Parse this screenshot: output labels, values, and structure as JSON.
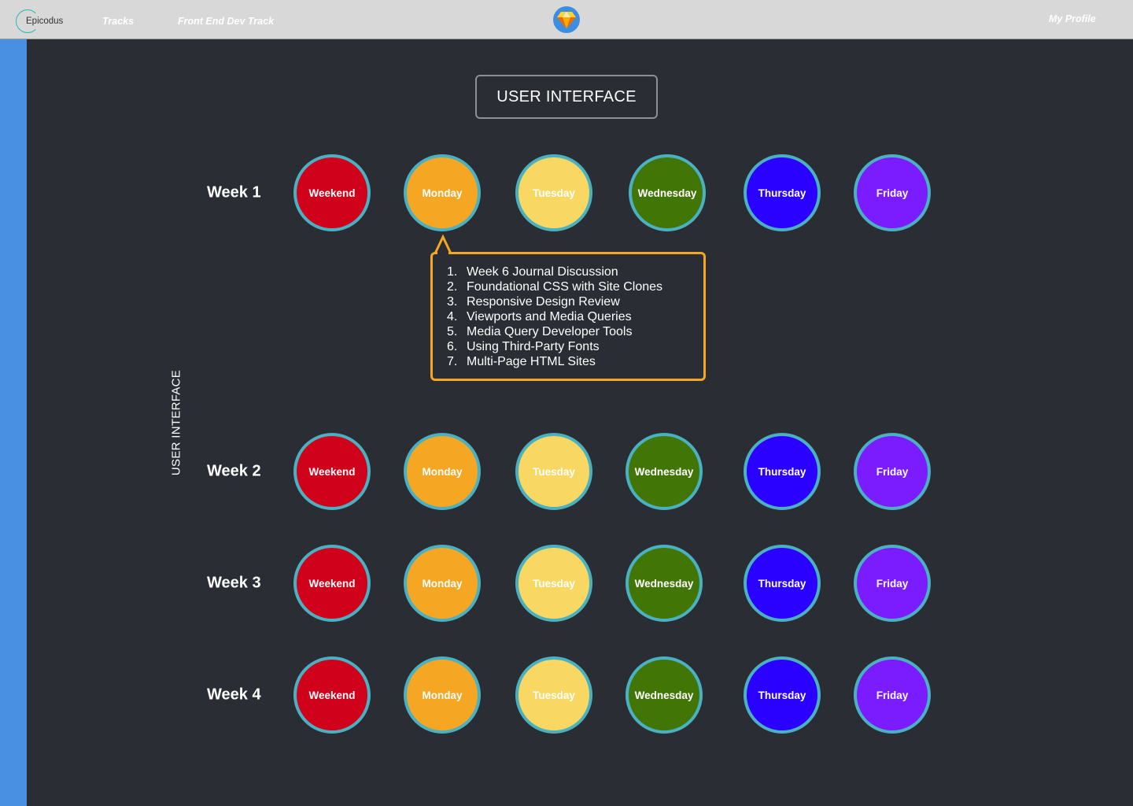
{
  "nav": {
    "logo_text": "Epicodus",
    "tracks_label": "Tracks",
    "track_label": "Front End Dev Track",
    "profile_label": "My Profile"
  },
  "page": {
    "title": "USER INTERFACE",
    "side_label": "USER INTERFACE"
  },
  "colors": {
    "weekend": "#d0021b",
    "monday": "#f5a623",
    "tuesday": "#f8d862",
    "wednesday": "#417505",
    "thursday": "#2a00ff",
    "friday": "#7b1bff",
    "circle_border": "#4ab1c2",
    "popover_border": "#f5a623",
    "side_strip": "#4990e2",
    "background": "#2a2d34"
  },
  "days": [
    "Weekend",
    "Monday",
    "Tuesday",
    "Wednesday",
    "Thursday",
    "Friday"
  ],
  "weeks": [
    {
      "label": "Week 1"
    },
    {
      "label": "Week 2"
    },
    {
      "label": "Week 3"
    },
    {
      "label": "Week 4"
    }
  ],
  "popover": {
    "items": [
      {
        "num": "1.",
        "text": "Week 6 Journal Discussion"
      },
      {
        "num": "2.",
        "text": "Foundational CSS with Site Clones"
      },
      {
        "num": "3.",
        "text": "Responsive Design Review"
      },
      {
        "num": "4.",
        "text": "Viewports and Media Queries"
      },
      {
        "num": "5.",
        "text": "Media Query Developer Tools"
      },
      {
        "num": "6.",
        "text": "Using Third-Party Fonts"
      },
      {
        "num": "7.",
        "text": "Multi-Page HTML Sites"
      }
    ]
  }
}
